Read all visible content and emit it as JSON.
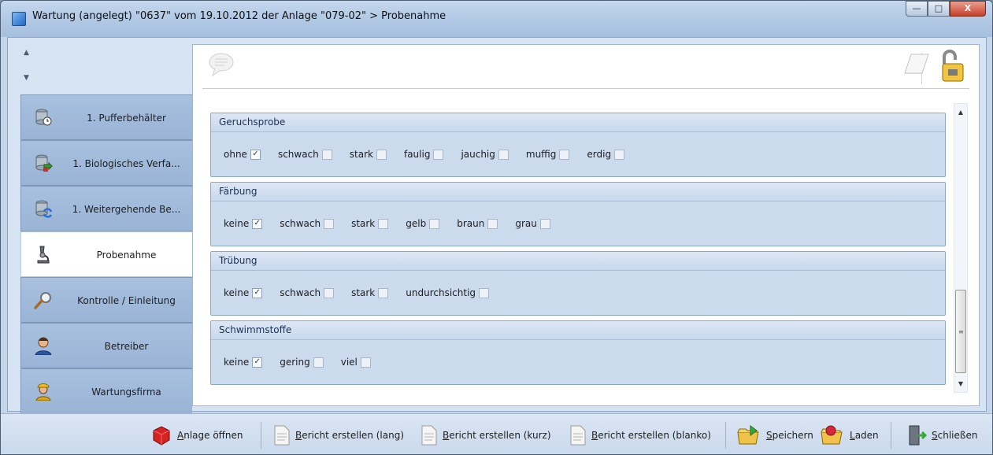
{
  "window": {
    "title": "Wartung (angelegt) \"0637\" vom 19.10.2012 der Anlage \"079-02\" > Probenahme",
    "controls": {
      "minimize": "—",
      "maximize": "□",
      "close": "X"
    }
  },
  "sidebar": {
    "items": [
      {
        "label": "1. Pufferbehälter",
        "icon": "database-clock-icon",
        "active": false
      },
      {
        "label": "1. Biologisches Verfa...",
        "icon": "database-arrow-icon",
        "active": false
      },
      {
        "label": "1. Weitergehende Be...",
        "icon": "database-refresh-icon",
        "active": false
      },
      {
        "label": "Probenahme",
        "icon": "microscope-icon",
        "active": true
      },
      {
        "label": "Kontrolle / Einleitung",
        "icon": "magnifier-icon",
        "active": false
      },
      {
        "label": "Betreiber",
        "icon": "person-icon",
        "active": false
      },
      {
        "label": "Wartungsfirma",
        "icon": "worker-icon",
        "active": false
      }
    ]
  },
  "groups": [
    {
      "title": "Geruchsprobe",
      "options": [
        {
          "label": "ohne",
          "checked": true
        },
        {
          "label": "schwach",
          "checked": false
        },
        {
          "label": "stark",
          "checked": false
        },
        {
          "label": "faulig",
          "checked": false
        },
        {
          "label": "jauchig",
          "checked": false
        },
        {
          "label": "muffig",
          "checked": false
        },
        {
          "label": "erdig",
          "checked": false
        }
      ]
    },
    {
      "title": "Färbung",
      "options": [
        {
          "label": "keine",
          "checked": true
        },
        {
          "label": "schwach",
          "checked": false
        },
        {
          "label": "stark",
          "checked": false
        },
        {
          "label": "gelb",
          "checked": false
        },
        {
          "label": "braun",
          "checked": false
        },
        {
          "label": "grau",
          "checked": false
        }
      ]
    },
    {
      "title": "Trübung",
      "options": [
        {
          "label": "keine",
          "checked": true
        },
        {
          "label": "schwach",
          "checked": false
        },
        {
          "label": "stark",
          "checked": false
        },
        {
          "label": "undurchsichtig",
          "checked": false
        }
      ]
    },
    {
      "title": "Schwimmstoffe",
      "options": [
        {
          "label": "keine",
          "checked": true
        },
        {
          "label": "gering",
          "checked": false
        },
        {
          "label": "viel",
          "checked": false
        }
      ]
    }
  ],
  "toolbar": {
    "anlage_oeffnen": "Anlage öffnen",
    "bericht_lang": "Bericht erstellen (lang)",
    "bericht_kurz": "Bericht erstellen (kurz)",
    "bericht_blanko": "Bericht erstellen (blanko)",
    "speichern": "Speichern",
    "laden": "Laden",
    "schliessen": "Schließen"
  },
  "icons": {
    "comment": "comment-bubble-icon",
    "note": "note-icon",
    "lock": "unlocked-padlock-icon"
  }
}
